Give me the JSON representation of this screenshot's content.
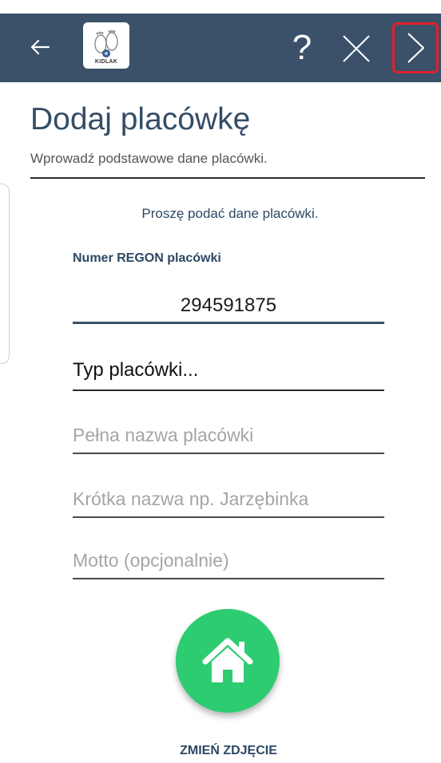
{
  "app": {
    "logo_text": "KIDLAK"
  },
  "toolbar": {
    "back_icon": "arrow-left-icon",
    "help_label": "?",
    "close_icon": "close-icon",
    "next_icon": "chevron-right-icon"
  },
  "page": {
    "title": "Dodaj placówkę",
    "subtitle": "Wprowadź podstawowe dane placówki."
  },
  "form": {
    "prompt": "Proszę podać dane placówki.",
    "regon_label": "Numer REGON placówki",
    "regon_value": "294591875",
    "type_select": "Typ placówki...",
    "full_name_placeholder": "Pełna nazwa placówki",
    "short_name_placeholder": "Krótka nazwa np. Jarzębinka",
    "motto_placeholder": "Motto (opcjonalnie)"
  },
  "photo": {
    "icon": "home-icon",
    "change_label": "ZMIEŃ ZDJĘCIE"
  },
  "colors": {
    "appbar": "#3a5169",
    "accent_text": "#2c4863",
    "photo_button": "#2ecc71",
    "highlight_border": "#e0202a"
  }
}
